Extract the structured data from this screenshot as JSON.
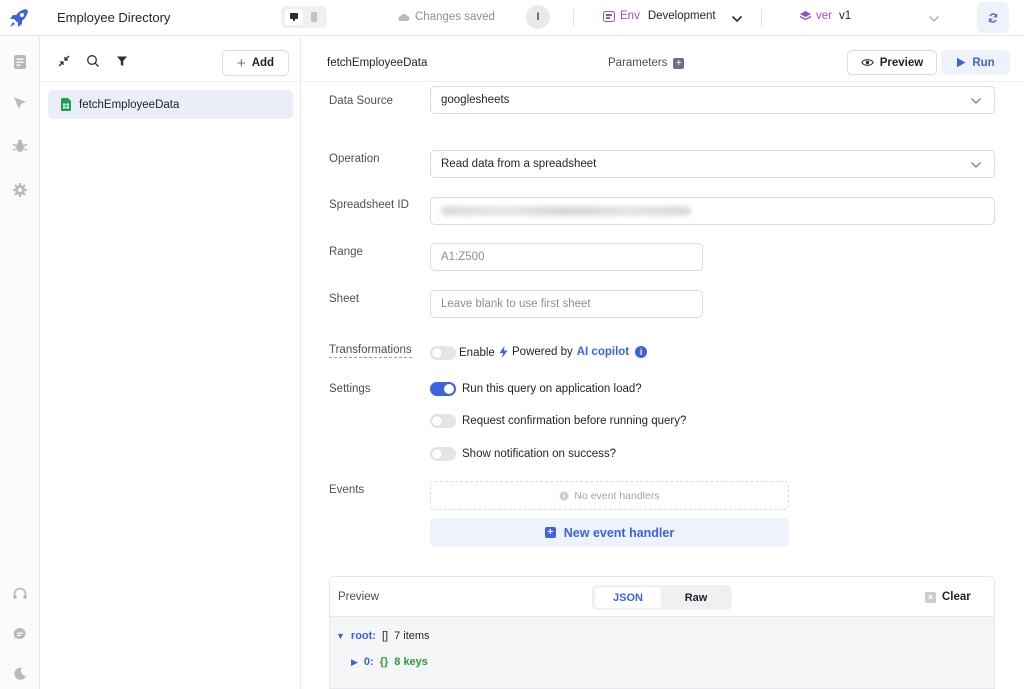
{
  "topbar": {
    "app_title": "Employee Directory",
    "save_status": "Changes saved",
    "avatar_initial": "I",
    "env_tag": "Env",
    "env_value": "Development",
    "version_tag": "ver",
    "version_value": "v1"
  },
  "query_list": {
    "add_label": "Add",
    "items": [
      {
        "label": "fetchEmployeeData",
        "icon": "googlesheets-icon"
      }
    ]
  },
  "editor": {
    "query_name": "fetchEmployeeData",
    "parameters_label": "Parameters",
    "preview_label": "Preview",
    "run_label": "Run",
    "fields": {
      "data_source": {
        "label": "Data Source",
        "value": "googlesheets"
      },
      "operation": {
        "label": "Operation",
        "value": "Read data from a spreadsheet"
      },
      "spreadsheet_id": {
        "label": "Spreadsheet ID"
      },
      "range": {
        "label": "Range",
        "placeholder": "A1:Z500"
      },
      "sheet": {
        "label": "Sheet",
        "placeholder": "Leave blank to use first sheet"
      }
    },
    "transformations": {
      "label": "Transformations",
      "enable_label": "Enable",
      "enabled": false,
      "powered_by": "Powered by",
      "copilot": "AI copilot"
    },
    "settings": {
      "label": "Settings",
      "options": [
        {
          "label": "Run this query on application load?",
          "on": true
        },
        {
          "label": "Request confirmation before running query?",
          "on": false
        },
        {
          "label": "Show notification on success?",
          "on": false
        }
      ]
    },
    "events": {
      "label": "Events",
      "empty_text": "No event handlers",
      "new_handler_label": "New event handler"
    },
    "preview_panel": {
      "title": "Preview",
      "tab_json": "JSON",
      "tab_raw": "Raw",
      "active_tab": "JSON",
      "clear_label": "Clear",
      "tree": {
        "root_key": "root:",
        "root_type": "[]",
        "root_summary": "7 items",
        "child_key": "0:",
        "child_type": "{}",
        "child_summary": "8 keys"
      }
    }
  },
  "colors": {
    "accent": "#3e63dd",
    "env_purple": "#9b4fc0",
    "selected_bg": "#e9eef9"
  }
}
